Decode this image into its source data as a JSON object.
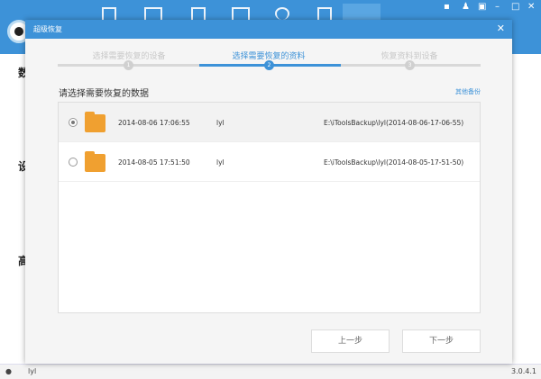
{
  "background": {
    "side_labels": [
      "数",
      "设",
      "高"
    ],
    "status_user": "lyl",
    "version": "3.0.4.1"
  },
  "dialog": {
    "title": "超级恢复",
    "steps": [
      {
        "label": "选择需要恢复的设备",
        "num": "1"
      },
      {
        "label": "选择需要恢复的资料",
        "num": "2"
      },
      {
        "label": "恢复资料到设备",
        "num": "3"
      }
    ],
    "prompt": "请选择需要恢复的数据",
    "other_backup": "其他备份",
    "backups": [
      {
        "date": "2014-08-06 17:06:55",
        "user": "lyl",
        "path": "E:\\iToolsBackup\\lyl(2014-08-06-17-06-55)",
        "selected": true
      },
      {
        "date": "2014-08-05 17:51:50",
        "user": "lyl",
        "path": "E:\\iToolsBackup\\lyl(2014-08-05-17-51-50)",
        "selected": false
      }
    ],
    "prev_label": "上一步",
    "next_label": "下一步"
  }
}
